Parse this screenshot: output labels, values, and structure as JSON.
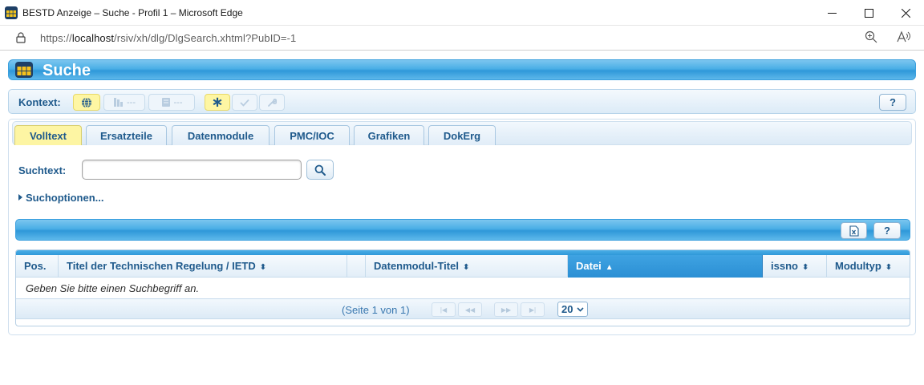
{
  "window": {
    "title": "BESTD Anzeige – Suche - Profil 1 – Microsoft Edge",
    "url_prefix": "https://",
    "url_host": "localhost",
    "url_path": "/rsiv/xh/dlg/DlgSearch.xhtml?PubID=-1"
  },
  "header": {
    "title": "Suche"
  },
  "kontext": {
    "label": "Kontext:",
    "item1": "---",
    "item2": "---",
    "help": "?"
  },
  "tabs": [
    {
      "label": "Volltext",
      "active": true
    },
    {
      "label": "Ersatzteile"
    },
    {
      "label": "Datenmodule"
    },
    {
      "label": "PMC/IOC"
    },
    {
      "label": "Grafiken"
    },
    {
      "label": "DokErg"
    }
  ],
  "search": {
    "label": "Suchtext:",
    "value": "",
    "placeholder": "",
    "options_label": "Suchoptionen..."
  },
  "results_toolbar": {
    "help": "?"
  },
  "table": {
    "columns": [
      {
        "label": "Pos.",
        "sortable": false
      },
      {
        "label": "Titel der Technischen Regelung / IETD",
        "sortable": true
      },
      {
        "label": "",
        "sortable": false
      },
      {
        "label": "Datenmodul-Titel",
        "sortable": true
      },
      {
        "label": "Datei",
        "sortable": true,
        "sorted": "asc"
      },
      {
        "label": "issno",
        "sortable": true
      },
      {
        "label": "Modultyp",
        "sortable": true
      }
    ],
    "empty_message": "Geben Sie bitte einen Suchbegriff an.",
    "pager_text": "(Seite 1 von 1)",
    "rows_per_page": "20"
  },
  "colors": {
    "accent_blue": "#2f98d9",
    "active_tab_yellow": "#fdf5a3",
    "text_blue": "#1f5a8c"
  }
}
